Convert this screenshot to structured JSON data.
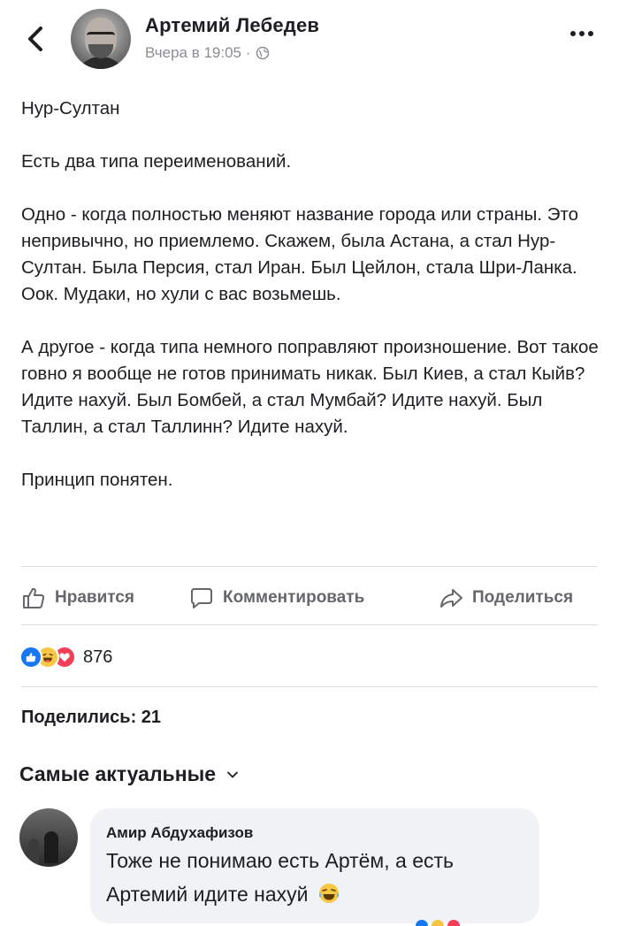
{
  "header": {
    "author": "Артемий Лебедев",
    "timestamp": "Вчера в 19:05 ·",
    "privacy_icon": "globe-icon",
    "back_icon": "chevron-left-icon",
    "more_icon": "more-horizontal-icon"
  },
  "post": {
    "paragraphs": [
      "Нур-Султан",
      "Есть два типа переименований.",
      "Одно - когда полностью меняют название города или страны. Это непривычно, но приемлемо. Скажем, была Астана, а стал Нур-Султан. Была Персия, стал Иран. Был Цейлон, стала Шри-Ланка. Оок. Мудаки, но хули с вас возьмешь.",
      "А другое - когда типа немного поправляют произношение. Вот такое говно я вообще не готов принимать никак. Был Киев, а стал Кыйв? Идите нахуй. Был Бомбей, а стал Мумбай? Идите нахуй. Был Таллин, а стал Таллинн? Идите нахуй.",
      "Принцип понятен."
    ]
  },
  "actions": {
    "like": "Нравится",
    "comment": "Комментировать",
    "share": "Поделиться"
  },
  "reactions": {
    "count": "876",
    "icons": [
      "like-reaction-icon",
      "haha-reaction-icon",
      "love-reaction-icon"
    ]
  },
  "shares": "Поделились: 21",
  "comments_sort": "Самые актуальные",
  "comment": {
    "author": "Амир Абдухафизов",
    "text": "Тоже не понимаю есть Артём, а есть Артемий идите нахуй",
    "emoji_icon": "laughing-tears-emoji-icon"
  },
  "colors": {
    "like_blue": "#1877f2",
    "haha_yellow": "#f7c644",
    "love_red": "#f33e58",
    "secondary_text": "#65676b",
    "bubble_bg": "#f0f2f5"
  }
}
